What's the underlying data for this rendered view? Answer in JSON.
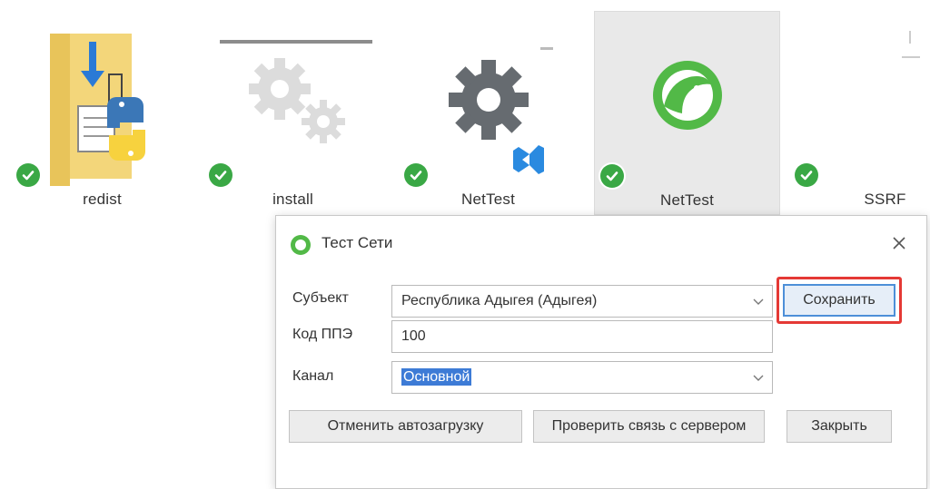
{
  "files": [
    {
      "name": "redist",
      "status_icon": "check-circle-icon"
    },
    {
      "name": "install",
      "status_icon": "check-circle-icon"
    },
    {
      "name": "NetTest",
      "status_icon": "check-circle-icon"
    },
    {
      "name": "NetTest",
      "status_icon": "check-circle-icon",
      "selected": true
    },
    {
      "name": "SSRF",
      "status_icon": "check-circle-icon"
    }
  ],
  "dialog": {
    "title": "Тест Сети",
    "fields": {
      "subject_label": "Субъект",
      "subject_value": "Республика Адыгея (Адыгея)",
      "code_label": "Код ППЭ",
      "code_value": "100",
      "channel_label": "Канал",
      "channel_value": "Основной"
    },
    "buttons": {
      "save": "Сохранить",
      "cancel_autoload": "Отменить автозагрузку",
      "check_connection": "Проверить связь с сервером",
      "close": "Закрыть"
    }
  },
  "colors": {
    "status_green": "#3aa845",
    "app_green": "#52b947",
    "annotation_red": "#e53935",
    "selection_blue": "#3d7bd6"
  }
}
